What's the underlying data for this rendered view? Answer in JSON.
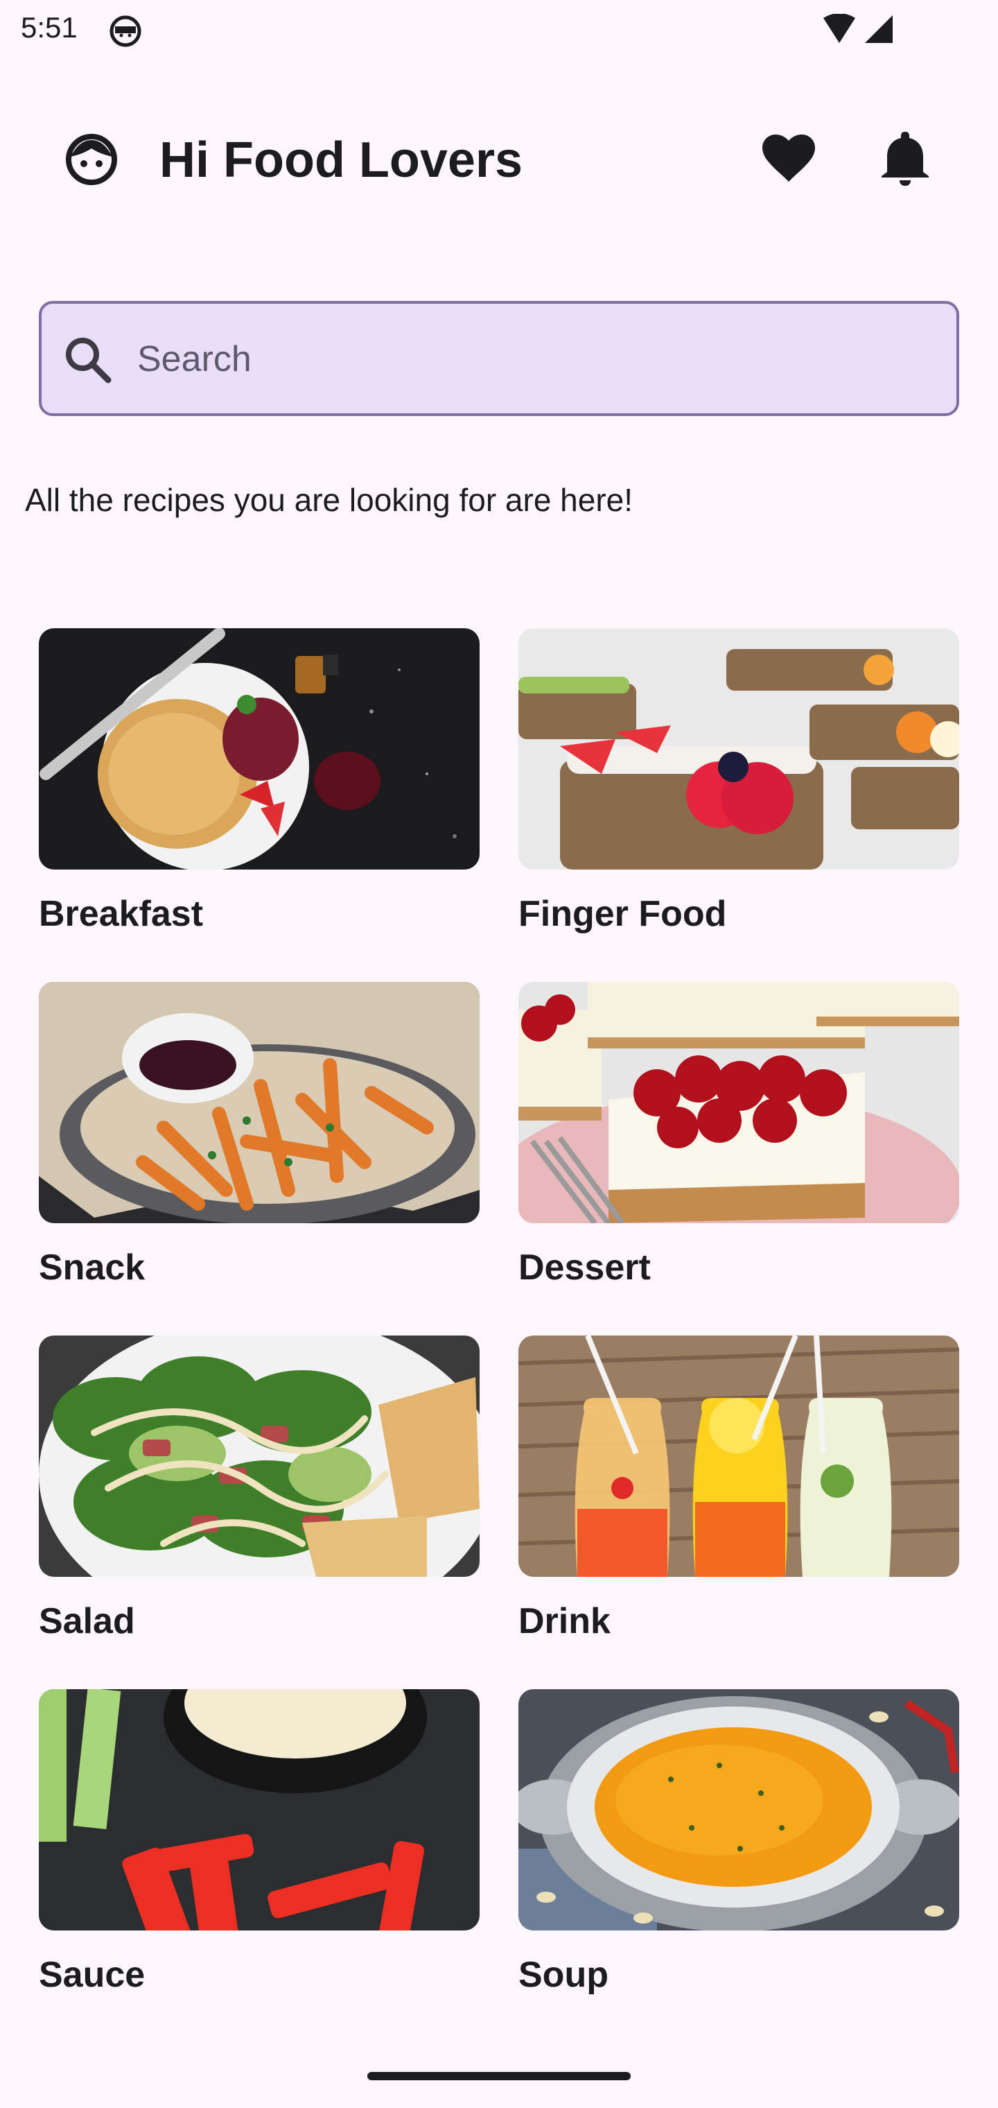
{
  "status_bar": {
    "time": "5:51"
  },
  "header": {
    "title": "Hi Food Lovers",
    "icons": [
      "face-icon",
      "heart-icon",
      "bell-icon"
    ]
  },
  "search": {
    "placeholder": "Search",
    "value": ""
  },
  "tagline": "All the recipes you are looking for are here!",
  "categories": [
    {
      "label": "Breakfast"
    },
    {
      "label": "Finger Food"
    },
    {
      "label": "Snack"
    },
    {
      "label": "Dessert"
    },
    {
      "label": "Salad"
    },
    {
      "label": "Drink"
    },
    {
      "label": "Sauce"
    },
    {
      "label": "Soup"
    }
  ],
  "colors": {
    "background": "#fdf7fd",
    "search_fill": "#e8def8",
    "search_border": "#7d6ea3",
    "text": "#1c1b1f"
  }
}
